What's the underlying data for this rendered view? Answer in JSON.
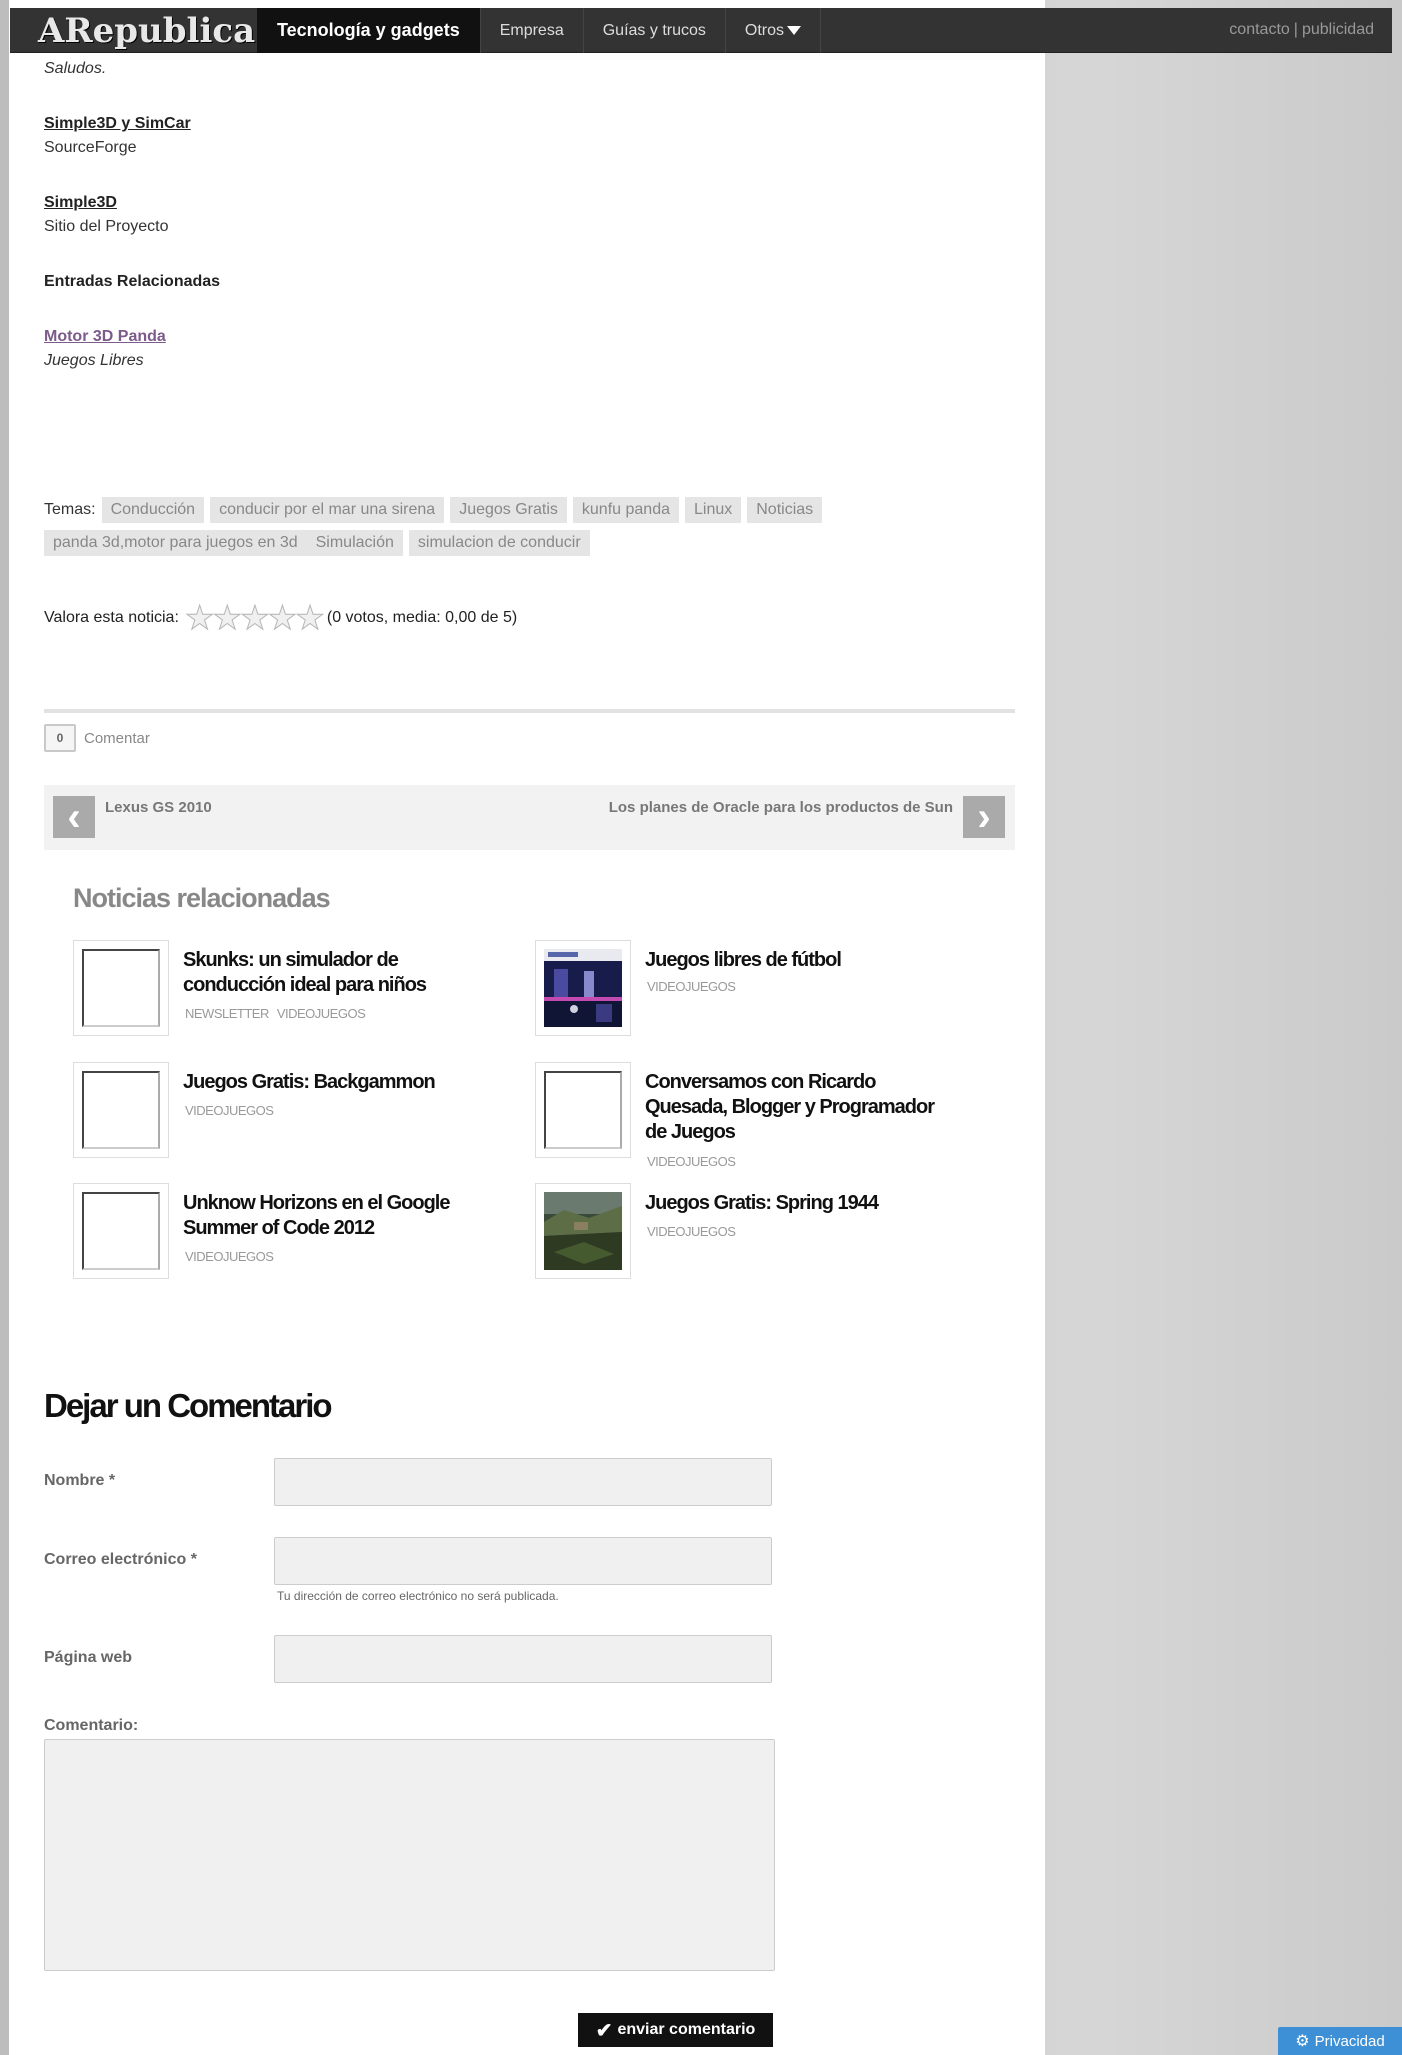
{
  "header": {
    "logo": "ARepublica",
    "nav": [
      "Tecnología y gadgets",
      "Empresa",
      "Guías y trucos",
      "Otros"
    ],
    "contact_link": "contacto",
    "separator": "|",
    "ads_link": "publicidad"
  },
  "article": {
    "greeting": "Saludos.",
    "links": [
      {
        "title": "Simple3D y SimCar",
        "desc": "SourceForge"
      },
      {
        "title": "Simple3D",
        "desc": "Sitio del Proyecto"
      }
    ],
    "related_entries_label": "Entradas Relacionadas",
    "related_entry": {
      "title": "Motor 3D Panda",
      "desc": "Juegos Libres"
    }
  },
  "tags": {
    "label": "Temas:",
    "items": [
      "Conducción",
      "conducir por el mar una sirena",
      "Juegos Gratis",
      "kunfu panda",
      "Linux",
      "Noticias",
      "panda 3d,motor para juegos en 3d",
      "Simulación",
      "simulacion de conducir"
    ]
  },
  "rating": {
    "label": "Valora esta noticia:",
    "summary": "(0 votos, media: 0,00 de 5)",
    "stars_filled": 0,
    "stars_total": 5
  },
  "comments": {
    "count": "0",
    "label": "Comentar"
  },
  "post_nav": {
    "prev": "Lexus GS 2010",
    "next": "Los planes de Oracle para los productos de Sun"
  },
  "related": {
    "heading": "Noticias relacionadas",
    "items": [
      {
        "title": "Skunks: un simulador de conducción ideal para niños",
        "cats": [
          "NEWSLETTER",
          "VIDEOJUEGOS"
        ]
      },
      {
        "title": "Juegos libres de fútbol",
        "cats": [
          "VIDEOJUEGOS"
        ]
      },
      {
        "title": "Juegos Gratis: Backgammon",
        "cats": [
          "VIDEOJUEGOS"
        ]
      },
      {
        "title": "Conversamos con Ricardo Quesada, Blogger y Programador de Juegos",
        "cats": [
          "VIDEOJUEGOS"
        ]
      },
      {
        "title": "Unknow Horizons en el Google Summer of Code 2012",
        "cats": [
          "VIDEOJUEGOS"
        ]
      },
      {
        "title": "Juegos Gratis: Spring 1944",
        "cats": [
          "VIDEOJUEGOS"
        ]
      }
    ]
  },
  "form": {
    "heading": "Dejar un Comentario",
    "name_label": "Nombre *",
    "email_label": "Correo electrónico *",
    "email_hint": "Tu dirección de correo electrónico no será publicada.",
    "web_label": "Página web",
    "comment_label": "Comentario:",
    "submit_label": "enviar comentario"
  },
  "privacy": {
    "label": "Privacidad"
  }
}
